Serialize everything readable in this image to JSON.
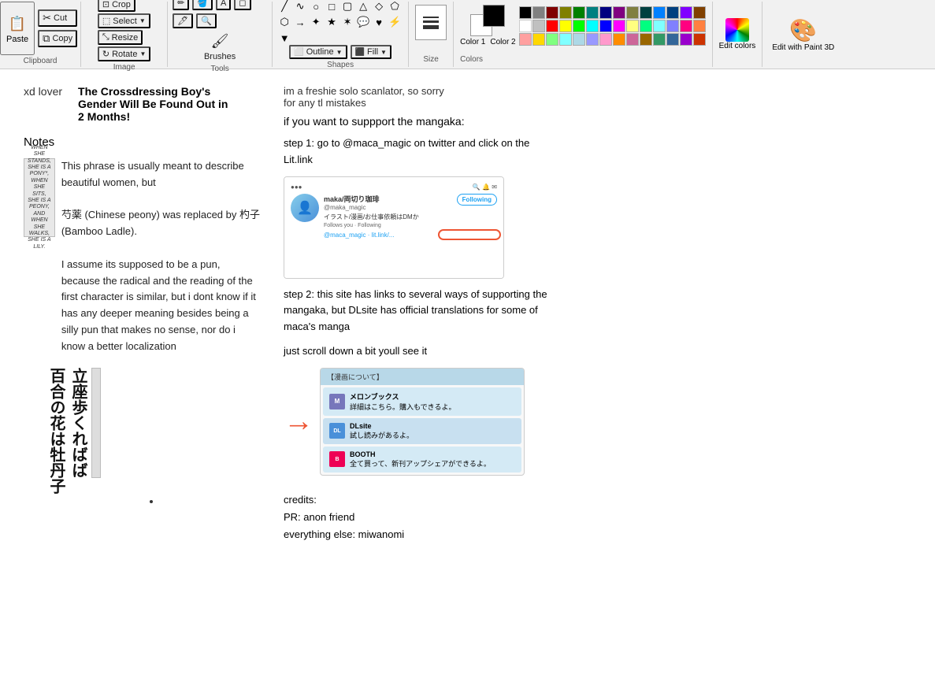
{
  "toolbar": {
    "clipboard_label": "Clipboard",
    "paste_label": "Paste",
    "cut_label": "Cut",
    "copy_label": "Copy",
    "image_label": "Image",
    "crop_label": "Crop",
    "select_label": "Select",
    "resize_label": "Resize",
    "rotate_label": "Rotate",
    "tools_label": "Tools",
    "brushes_label": "Brushes",
    "outline_label": "Outline",
    "fill_label": "Fill",
    "shapes_label": "Shapes",
    "colors_label": "Colors",
    "color1_label": "Color 1",
    "color2_label": "Color 2",
    "edit_colors_label": "Edit colors",
    "edit_with_paint3d_label": "Edit with Paint 3D",
    "size_label": "Size"
  },
  "header": {
    "username": "xd lover",
    "title": "The Crossdressing Boy's Gender Will Be Found Out in 2 Months!",
    "note": "im a freshie solo scanlator, so sorry for any tl mistakes"
  },
  "notes": {
    "label": "Notes",
    "phrase_note": "This phrase is usually meant to describe beautiful women, but",
    "peony_text": "芍薬 (Chinese peony) was replaced by 杓子 (Bamboo Ladle).",
    "assumption_text": "I assume its supposed to be a pun, because the radical and the reading of the first character is similar, but i dont know if it has any deeper meaning besides being a silly pun that makes no sense, nor do i know a better localization",
    "vertical_text": "百合の花は牡丹子立座歩くればば",
    "thumbnail_text": "WHEN SHE STANDS, SHE IS A PONY*, WHEN SHE SITS, SHE IS A PEONY, AND WHEN SHE WALKS, SHE IS A LILY."
  },
  "support": {
    "heading": "if you want to suppport the mangaka:",
    "step1_label": "step 1: go to @maca_magic on twitter and click on the Lit.link",
    "step2_label": "step 2: this site has links to several ways of supporting the mangaka, but DLsite has official translations for some of maca's manga",
    "step3_label": "just scroll down a bit youll see it",
    "twitter_name": "maka/両切り珈琲",
    "twitter_handle": "@maka_magic",
    "twitter_bio": "イラスト/漫画/お仕事依頼はDMか",
    "twitter_stats": "Follows you · Following",
    "follow_btn": "Following",
    "step2_header": "【漫画について】",
    "item1_name": "メロンブックス",
    "item1_desc": "詳細はこちら。購入もできるよ。",
    "item2_name": "DLsite",
    "item2_desc": "試し読みがあるよ。",
    "item3_name": "BOOTH",
    "item3_desc": "全て買って、新刊アップシェアができるよ。"
  },
  "credits": {
    "label": "credits:",
    "pr_label": "PR: anon friend",
    "everything_label": "everything else: miwanomi"
  },
  "colors": {
    "palette": [
      "#000000",
      "#808080",
      "#800000",
      "#808000",
      "#008000",
      "#008080",
      "#000080",
      "#800080",
      "#808040",
      "#004040",
      "#0080FF",
      "#004080",
      "#8000FF",
      "#804000",
      "#FFFFFF",
      "#C0C0C0",
      "#FF0000",
      "#FFFF00",
      "#00FF00",
      "#00FFFF",
      "#0000FF",
      "#FF00FF",
      "#FFFF80",
      "#00FF80",
      "#80FFFF",
      "#8080FF",
      "#FF0080",
      "#FF8040",
      "#FFA0A0",
      "#FFD700",
      "#80FF80",
      "#80FFFF",
      "#ADD8E6",
      "#9999FF",
      "#FF99CC",
      "#FF8C00",
      "#CC6699",
      "#996600",
      "#339966",
      "#336699",
      "#9900CC",
      "#CC3300"
    ]
  }
}
